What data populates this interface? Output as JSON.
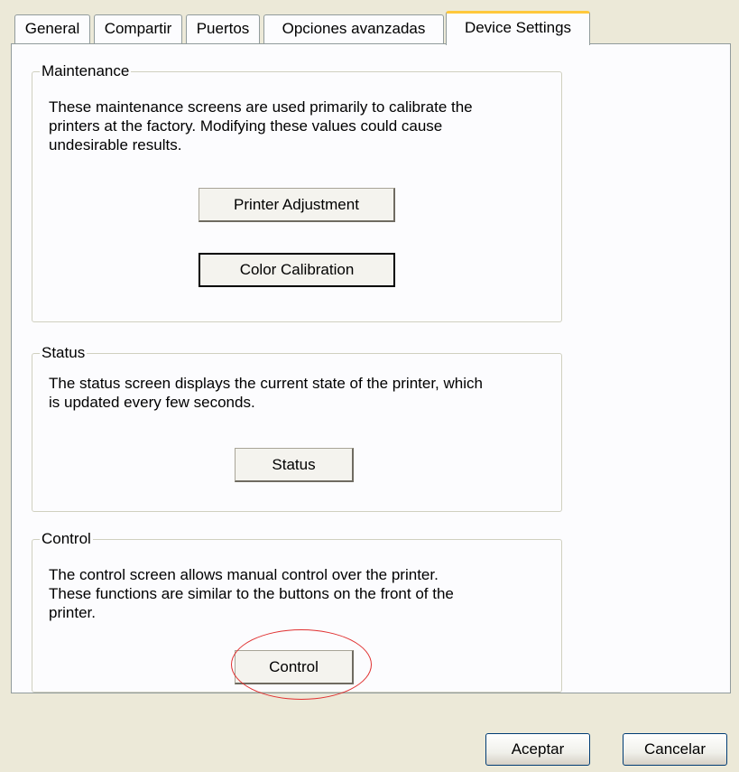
{
  "tabs": [
    {
      "label": "General",
      "active": false
    },
    {
      "label": "Compartir",
      "active": false
    },
    {
      "label": "Puertos",
      "active": false
    },
    {
      "label": "Opciones avanzadas",
      "active": false
    },
    {
      "label": "Device Settings",
      "active": true
    }
  ],
  "maintenance": {
    "title": "Maintenance",
    "description": "These maintenance screens are used primarily to calibrate the\nprinters at the factory.  Modifying these values could cause\nundesirable results.",
    "printer_adjustment_label": "Printer Adjustment",
    "color_calibration_label": "Color Calibration"
  },
  "status": {
    "title": "Status",
    "description": "The status screen displays the current state of the printer, which\nis updated every few seconds.",
    "button_label": "Status"
  },
  "control": {
    "title": "Control",
    "description": "The control screen allows manual control over the printer.\nThese functions are similar to the buttons on the front of the\nprinter.",
    "button_label": "Control",
    "highlight_color": "#e03030"
  },
  "footer": {
    "ok_label": "Aceptar",
    "cancel_label": "Cancelar"
  }
}
